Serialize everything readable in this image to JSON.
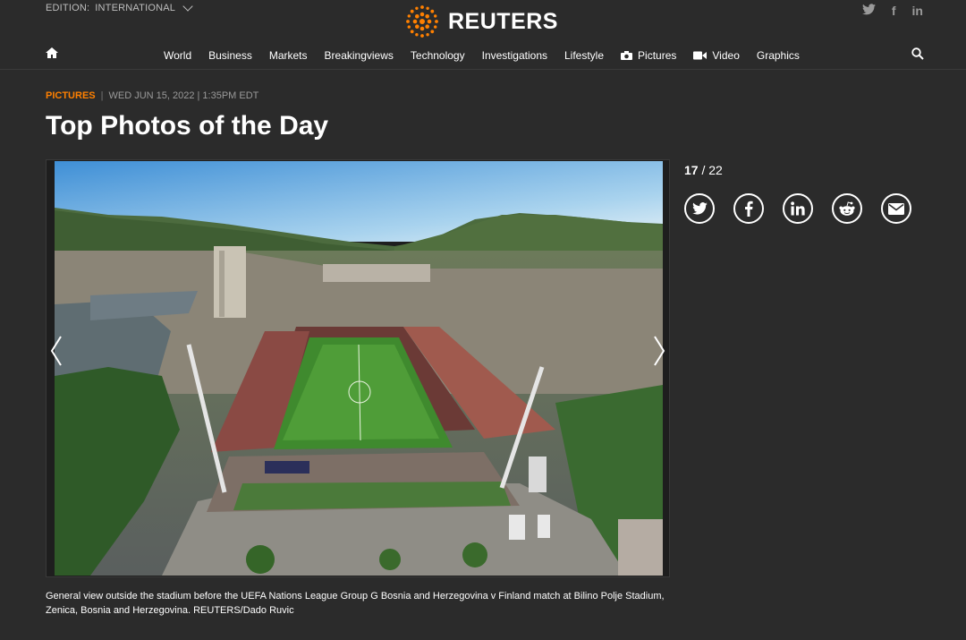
{
  "header": {
    "edition_label": "EDITION:",
    "edition_value": "INTERNATIONAL",
    "logo_text": "REUTERS",
    "social": {
      "twitter": "twitter-icon",
      "facebook": "f",
      "linkedin": "in"
    }
  },
  "nav": {
    "items": [
      {
        "label": "World"
      },
      {
        "label": "Business"
      },
      {
        "label": "Markets"
      },
      {
        "label": "Breakingviews"
      },
      {
        "label": "Technology"
      },
      {
        "label": "Investigations"
      },
      {
        "label": "Lifestyle"
      },
      {
        "label": "Pictures",
        "icon": "camera-icon"
      },
      {
        "label": "Video",
        "icon": "video-icon"
      },
      {
        "label": "Graphics"
      }
    ]
  },
  "article": {
    "section": "PICTURES",
    "separator": "|",
    "date": "WED JUN 15, 2022 | 1:35PM EDT",
    "title": "Top Photos of the Day",
    "counter_current": "17",
    "counter_total": "/ 22",
    "caption": "General view outside the stadium before the UEFA Nations League Group G Bosnia and Herzegovina v Finland match at Bilino Polje Stadium, Zenica, Bosnia and Herzegovina. REUTERS/Dado Ruvic"
  },
  "share_icons": [
    "twitter-icon",
    "facebook-icon",
    "linkedin-icon",
    "reddit-icon",
    "email-icon"
  ],
  "colors": {
    "accent": "#ff8000",
    "background": "#2b2b2b",
    "logo_orange": "#ff8000"
  }
}
